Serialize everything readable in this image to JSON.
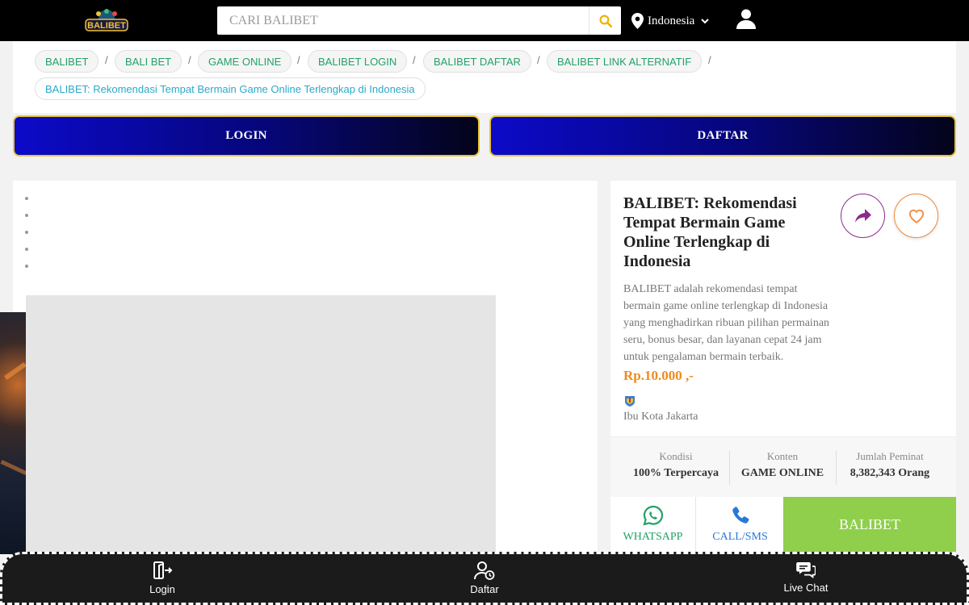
{
  "header": {
    "logo_text": "BALIBET",
    "search_placeholder": "CARI BALIBET",
    "location": "Indonesia"
  },
  "breadcrumbs": [
    "BALIBET",
    "BALI BET",
    "GAME ONLINE",
    "BALIBET LOGIN",
    "BALIBET DAFTAR",
    "BALIBET LINK ALTERNATIF",
    "BALIBET: Rekomendasi Tempat Bermain Game Online Terlengkap di Indonesia"
  ],
  "breadcrumb_separator": "/",
  "actions": {
    "login": "LOGIN",
    "daftar": "DAFTAR"
  },
  "product": {
    "title": "BALIBET: Rekomendasi Tempat Bermain Game Online Terlengkap di Indonesia",
    "description": "BALIBET adalah rekomendasi tempat bermain game online terlengkap di Indonesia yang menghadirkan ribuan pilihan permainan seru, bonus besar, dan layanan cepat 24 jam untuk pengalaman bermain terbaik.",
    "price": "Rp.10.000 ,-",
    "city": "Ibu Kota Jakarta",
    "stats": [
      {
        "label": "Kondisi",
        "value": "100% Terpercaya"
      },
      {
        "label": "Konten",
        "value": "GAME ONLINE"
      },
      {
        "label": "Jumlah Peminat",
        "value": "8,382,343 Orang"
      }
    ],
    "cta": {
      "whatsapp": "WHATSAPP",
      "call": "CALL/SMS",
      "main": "BALIBET"
    }
  },
  "bottom_nav": [
    {
      "label": "Login",
      "icon": "login-icon"
    },
    {
      "label": "Daftar",
      "icon": "register-icon"
    },
    {
      "label": "Live Chat",
      "icon": "chat-icon"
    }
  ],
  "colors": {
    "accent_green": "#21a366",
    "price_orange": "#f08a1c",
    "cta_green": "#8fcf4b",
    "button_border_gold": "#e8c437"
  }
}
